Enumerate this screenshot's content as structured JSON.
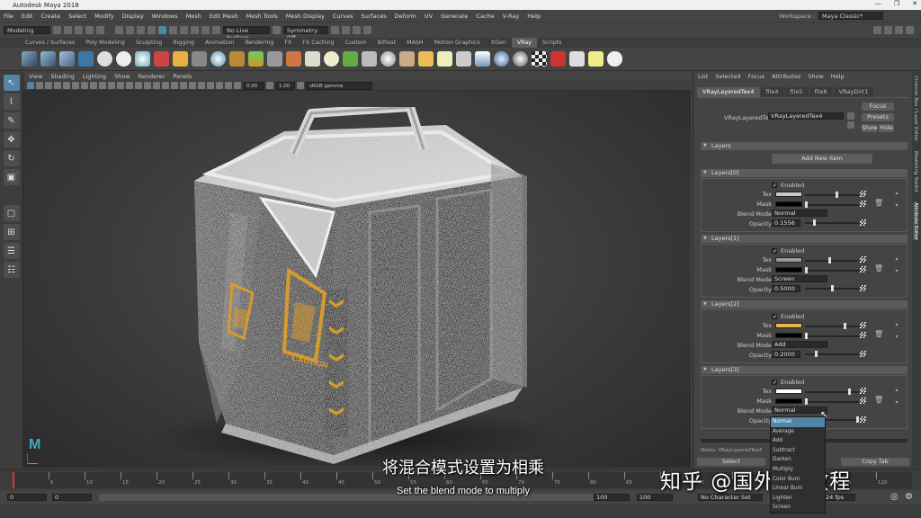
{
  "app": {
    "title": "Autodesk Maya 2018"
  },
  "menubar": {
    "items": [
      "File",
      "Edit",
      "Create",
      "Select",
      "Modify",
      "Display",
      "Windows",
      "Mesh",
      "Edit Mesh",
      "Mesh Tools",
      "Mesh Display",
      "Curves",
      "Surfaces",
      "Deform",
      "UV",
      "Generate",
      "Cache",
      "V-Ray",
      "Help"
    ],
    "workspace_label": "Workspace :",
    "workspace_value": "Maya Classic*"
  },
  "statusline": {
    "mode": "Modeling",
    "live_surface": "No Live Surface",
    "symmetry": "Symmetry: Off"
  },
  "shelf": {
    "tabs": [
      "Curves / Surfaces",
      "Poly Modeling",
      "Sculpting",
      "Rigging",
      "Animation",
      "Rendering",
      "FX",
      "FX Caching",
      "Custom",
      "Bifrost",
      "MASH",
      "Motion Graphics",
      "XGen",
      "VRay",
      "Scripts"
    ],
    "active_tab": "VRay"
  },
  "viewport": {
    "menu": [
      "View",
      "Shading",
      "Lighting",
      "Show",
      "Renderer",
      "Panels"
    ],
    "exposure": "0.00",
    "gamma": "1.00",
    "colorspace": "sRGB gamma"
  },
  "crate": {
    "decal_text": "CAUTION"
  },
  "attribute_editor": {
    "menu": [
      "List",
      "Selected",
      "Focus",
      "Attributes",
      "Show",
      "Help"
    ],
    "tabs": [
      "VRayLayeredTex4",
      "file4",
      "file5",
      "file6",
      "VRayDirt1"
    ],
    "node_label": "VRayLayeredTex:",
    "node_name": "VRayLayeredTex4",
    "focus_button": "Focus",
    "presets_button": "Presets",
    "show_button": "Show",
    "hide_button": "Hide",
    "layers_section": "Layers",
    "add_item_button": "Add New Item",
    "enabled_label": "Enabled",
    "tex_label": "Tex",
    "mask_label": "Mask",
    "blend_label": "Blend Mode",
    "opacity_label": "Opacity",
    "layers": [
      {
        "header": "Layers[0]",
        "blend": "Normal",
        "opacity": "0.1556",
        "opacity_level": 0.16,
        "tex_color": "#c8c8c8",
        "tex_level": 0.6
      },
      {
        "header": "Layers[1]",
        "blend": "Screen",
        "opacity": "0.5000",
        "opacity_level": 0.5,
        "tex_color": "#9a9a9a",
        "tex_level": 0.45
      },
      {
        "header": "Layers[2]",
        "blend": "Add",
        "opacity": "0.2000",
        "opacity_level": 0.2,
        "tex_color": "#e8b84a",
        "tex_level": 0.75
      },
      {
        "header": "Layers[3]",
        "blend": "Normal",
        "opacity": "",
        "opacity_level": 1.0,
        "tex_color": "#ffffff",
        "tex_level": 0.85
      }
    ],
    "blend_options": [
      "Normal",
      "Average",
      "Add",
      "Subtract",
      "Darken",
      "Multiply",
      "Color Burn",
      "Linear Burn",
      "Lighten",
      "Screen"
    ],
    "notes_label": "Notes:  VRayLayeredTex4",
    "select_button": "Select",
    "copy_tab_button": "Copy Tab"
  },
  "side_tabs": [
    "Channel Box / Layer Editor",
    "Modelling Toolkit",
    "Attribute Editor"
  ],
  "time": {
    "ticks": [
      "5",
      "10",
      "15",
      "20",
      "25",
      "30",
      "35",
      "40",
      "45",
      "50",
      "55",
      "60",
      "65",
      "70",
      "75",
      "80",
      "85",
      "90",
      "95",
      "100",
      "105",
      "110",
      "115",
      "120"
    ],
    "start": "0",
    "start_inner": "0",
    "range_end": "100",
    "end": "100",
    "character_set": "No Character Set",
    "fps": "24 fps"
  },
  "overlay": {
    "subtitle_cn": "将混合模式设置为相乘",
    "subtitle_en": "Set the blend mode to multiply",
    "watermark": "知乎 @国外CG教程"
  }
}
